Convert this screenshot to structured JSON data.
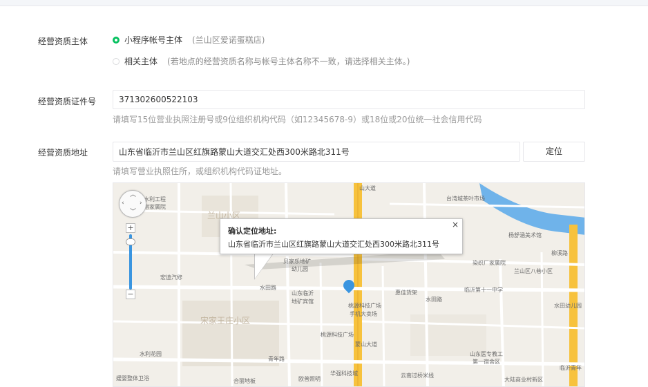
{
  "subject": {
    "label": "经营资质主体",
    "option1": "小程序帐号主体",
    "option1_note": "(兰山区爱诺蛋糕店)",
    "option2": "相关主体",
    "option2_note": "(若地点的经营资质名称与帐号主体名称不一致，请选择相关主体。)"
  },
  "license": {
    "label": "经营资质证件号",
    "value": "371302600522103",
    "hint": "请填写15位营业执照注册号或9位组织机构代码（如12345678-9）或18位或20位统一社会信用代码"
  },
  "address": {
    "label": "经营资质地址",
    "value": "山东省临沂市兰山区红旗路蒙山大道交汇处西300米路北311号",
    "locate_button": "定位",
    "hint": "请填写营业执照住所，或组织机构代码证地址。"
  },
  "map": {
    "info_title": "确认定位地址:",
    "info_address": "山东省临沂市兰山区红旗路蒙山大道交汇处西300米路北311号",
    "close_symbol": "×",
    "zoom_in": "+",
    "zoom_out": "−",
    "labels": [
      "水利工程",
      "宿家属院",
      "兰山小区",
      "台湾城茶叶市场",
      "杨舒涵美术馆",
      "柳溪路",
      "宏迪汽修",
      "贝家乐地矿",
      "幼儿园",
      "水田路",
      "染织厂家属院",
      "兰山区八巷小区",
      "山东临沂",
      "地矿宾馆",
      "桃源科技广场",
      "手机大卖场",
      "惠佳货架",
      "水田路",
      "临沂第十一中学",
      "水田幼儿园",
      "宋家王庄小区",
      "桃源科技广场",
      "水利花园",
      "青年路",
      "华强科技城",
      "欧普照明",
      "合丽地板",
      "嫒婴整体卫浴",
      "云南过桥米线",
      "山东医专教工",
      "第一宿舍区",
      "大陆商业村新区",
      "临沂青年",
      "山大道",
      "蒙山大道"
    ]
  }
}
